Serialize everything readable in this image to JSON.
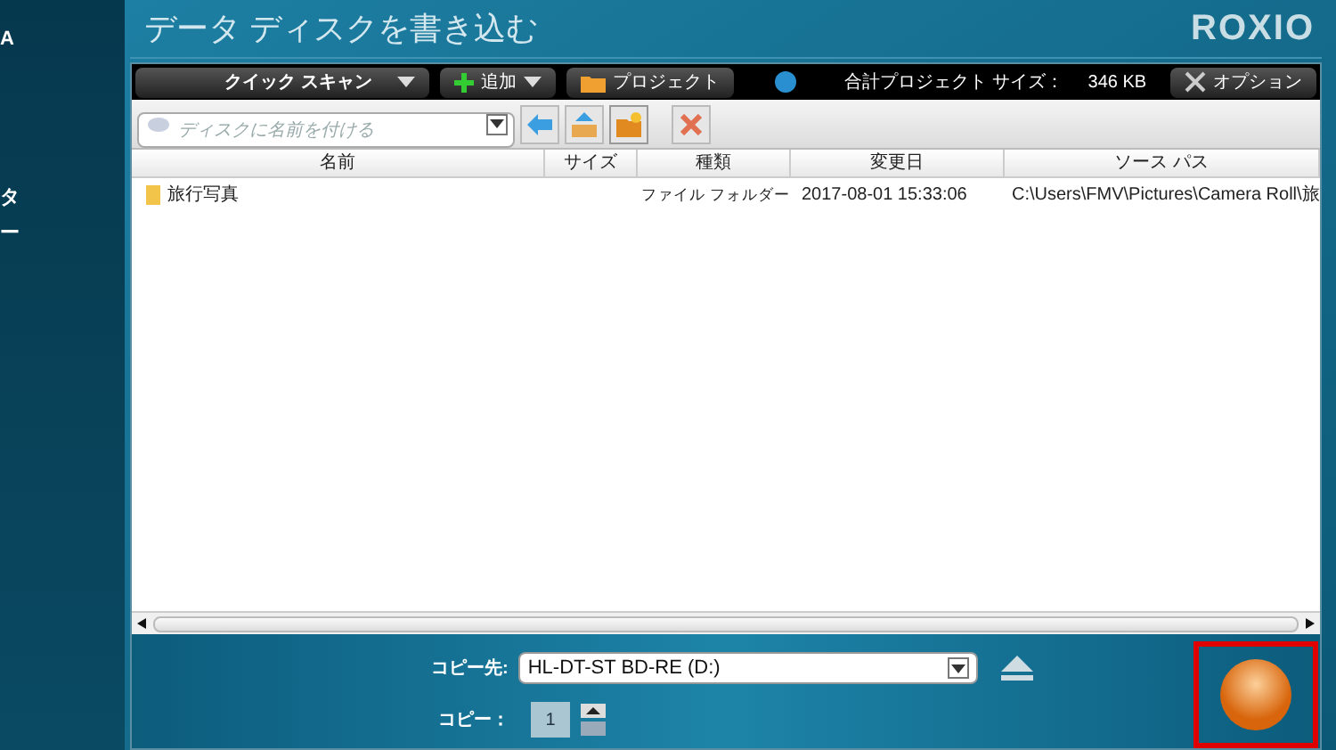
{
  "sidebar": {
    "items": [
      "A",
      "タ",
      "ー"
    ]
  },
  "title": "データ ディスクを書き込む",
  "logo": "ROXIO",
  "toolbar": {
    "scan": "クイック スキャン",
    "add": "追加",
    "project": "プロジェクト",
    "size_label": "合計プロジェクト サイズ：",
    "size_value": "346 KB",
    "options": "オプション"
  },
  "disc_name": {
    "placeholder": "ディスクに名前を付ける"
  },
  "table": {
    "columns": [
      "名前",
      "サイズ",
      "種類",
      "変更日",
      "ソース パス"
    ],
    "rows": [
      {
        "name": "旅行写真",
        "size": "",
        "type": "ファイル フォルダー",
        "modified": "2017-08-01 15:33:06",
        "source": "C:\\Users\\FMV\\Pictures\\Camera Roll\\旅"
      }
    ]
  },
  "destination": {
    "label": "コピー先:",
    "value": "HL-DT-ST BD-RE (D:)"
  },
  "copies": {
    "label": "コピー：",
    "value": "1"
  },
  "burn_button": {
    "highlighted": true
  }
}
